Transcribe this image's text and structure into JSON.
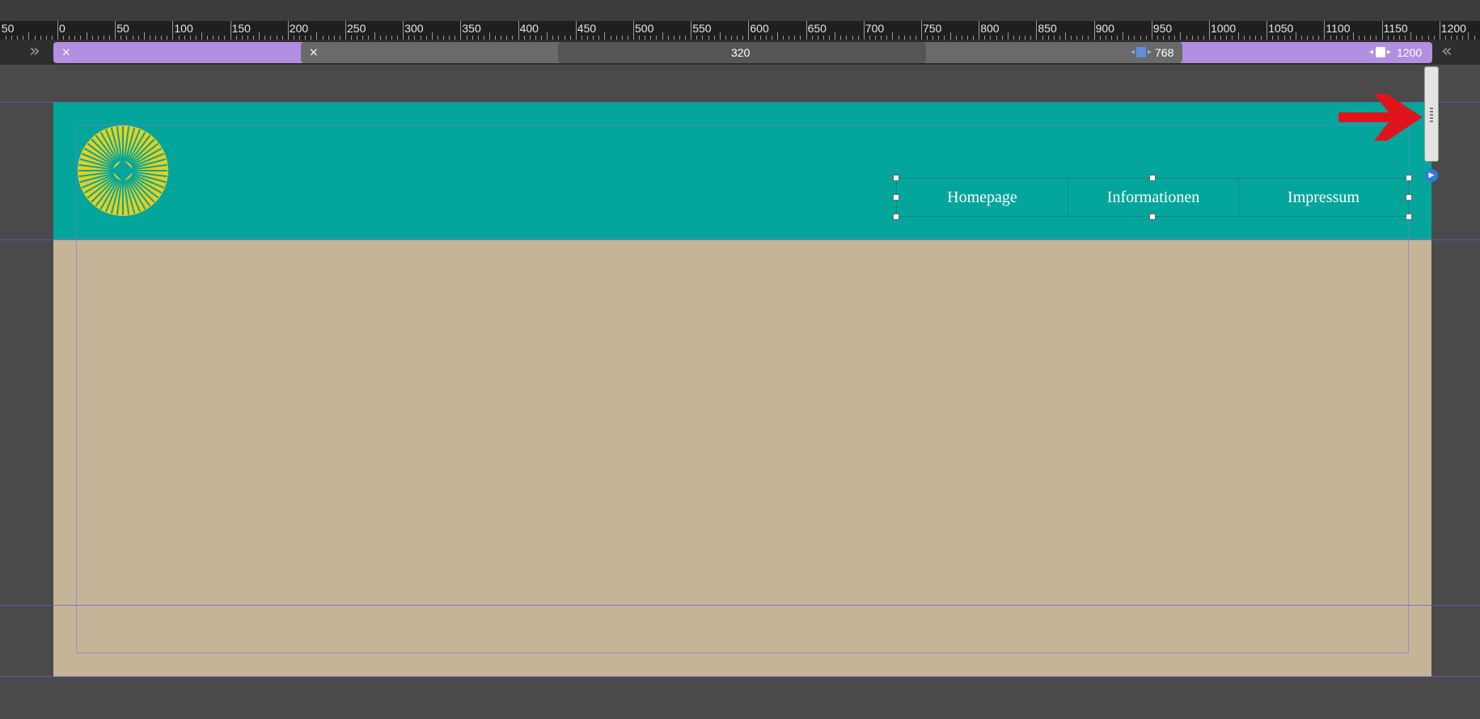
{
  "ruler": {
    "labels": [
      "50",
      "0",
      "50",
      "100",
      "150",
      "200",
      "250",
      "300",
      "350",
      "400",
      "450",
      "500",
      "550",
      "600",
      "650",
      "700",
      "750",
      "800",
      "850",
      "900",
      "950",
      "1000",
      "1050",
      "1100",
      "1150",
      "1200"
    ]
  },
  "breakpoints": {
    "close_symbol": "×",
    "small": "320",
    "medium": "768",
    "large": "1200"
  },
  "nav": {
    "items": [
      "Homepage",
      "Informationen",
      "Impressum"
    ]
  },
  "colors": {
    "header": "#04a69c",
    "page": "#c6b499",
    "logo": "#e6cf1e",
    "breakpoint_bar": "#b28fe0",
    "arrow": "#e0141c"
  }
}
